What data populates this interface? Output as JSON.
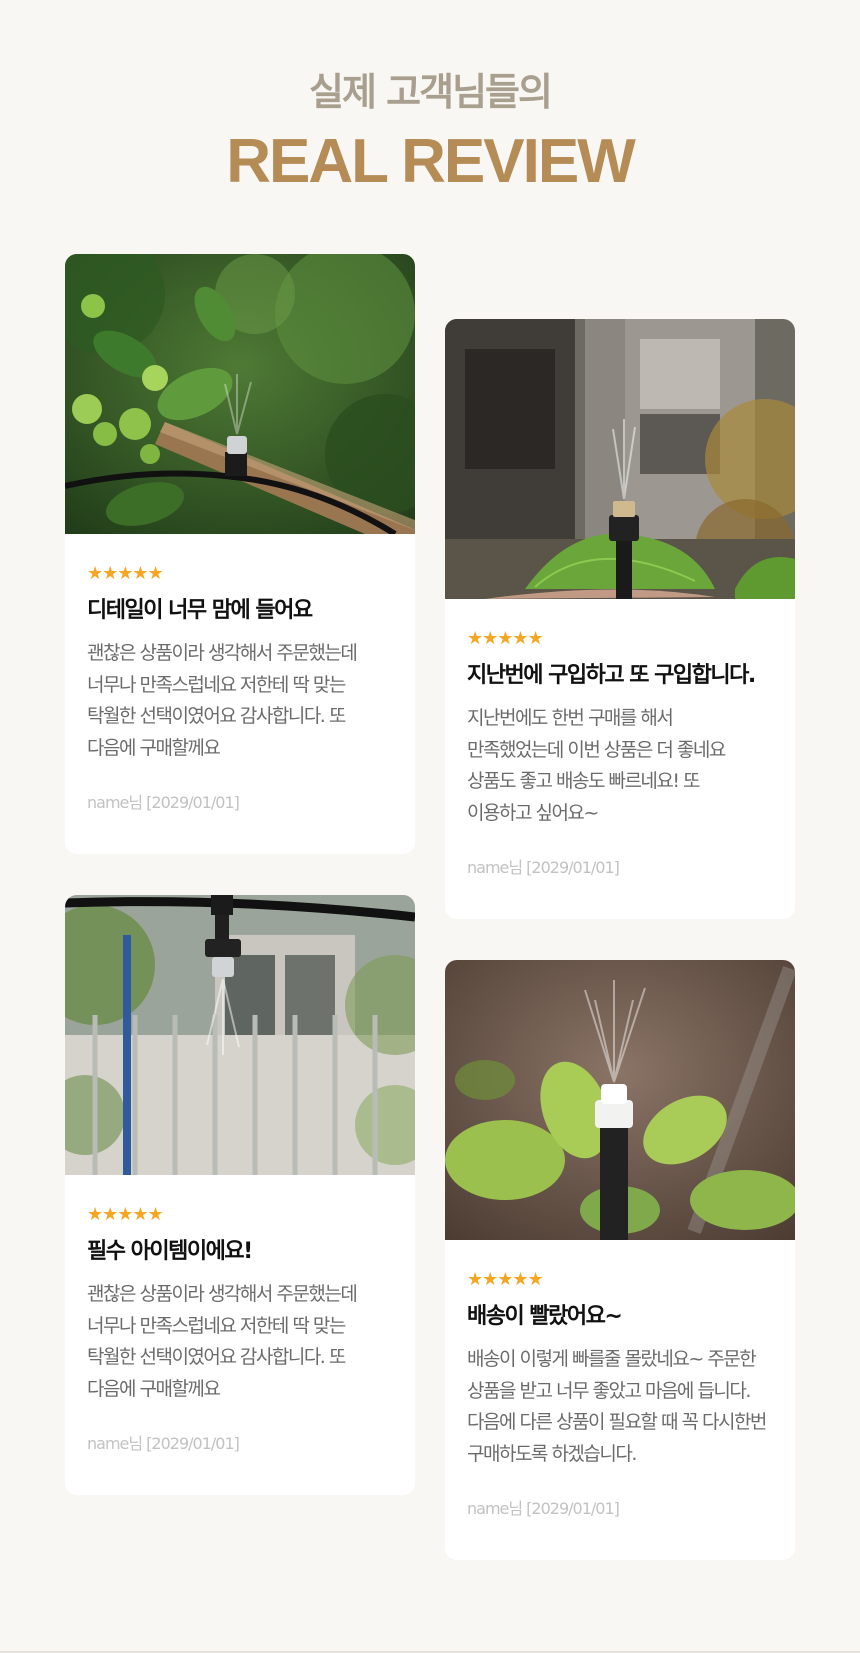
{
  "header": {
    "subtitle": "실제 고객님들의",
    "title": "REAL REVIEW"
  },
  "reviews": [
    {
      "stars": "★★★★★",
      "title": "디테일이 너무 맘에 들어요",
      "text": "괜찮은 상품이라 생각해서 주문했는데\n너무나 만족스럽네요 저한테 딱 맞는\n탁월한 선택이였어요 감사합니다. 또\n다음에 구매할께요",
      "meta": "name님 [2029/01/01]",
      "photo": "tomato-plant-sprinkler-photo"
    },
    {
      "stars": "★★★★★",
      "title": "지난번에 구입하고 또 구입합니다.",
      "text": "지난번에도 한번 구매를 해서\n만족했었는데 이번 상품은 더 좋네요\n상품도 좋고 배송도 빠르네요! 또\n이용하고 싶어요~",
      "meta": "name님 [2029/01/01]",
      "photo": "mist-nozzle-building-photo"
    },
    {
      "stars": "★★★★★",
      "title": "필수 아이템이에요!",
      "text": "괜찮은 상품이라 생각해서 주문했는데\n너무나 만족스럽네요 저한테 딱 맞는\n탁월한 선택이였어요 감사합니다. 또\n다음에 구매할께요",
      "meta": "name님 [2029/01/01]",
      "photo": "hanging-mist-nozzle-photo"
    },
    {
      "stars": "★★★★★",
      "title": "배송이 빨랐어요~",
      "text": "배송이 이렇게 빠를줄 몰랐네요~ 주문한\n상품을 받고 너무 좋았고 마음에 듭니다.\n다음에 다른 상품이 필요할 때 꼭 다시한번\n구매하도록 하겠습니다.",
      "meta": "name님 [2029/01/01]",
      "photo": "white-mist-nozzle-photo"
    }
  ],
  "colors": {
    "background": "#f9f7f3",
    "subtitle": "#a89f8e",
    "title": "#b58b56",
    "stars": "#f5a623",
    "review_title": "#111111",
    "review_text": "#6b6b6b",
    "meta": "#c2c2c2"
  }
}
